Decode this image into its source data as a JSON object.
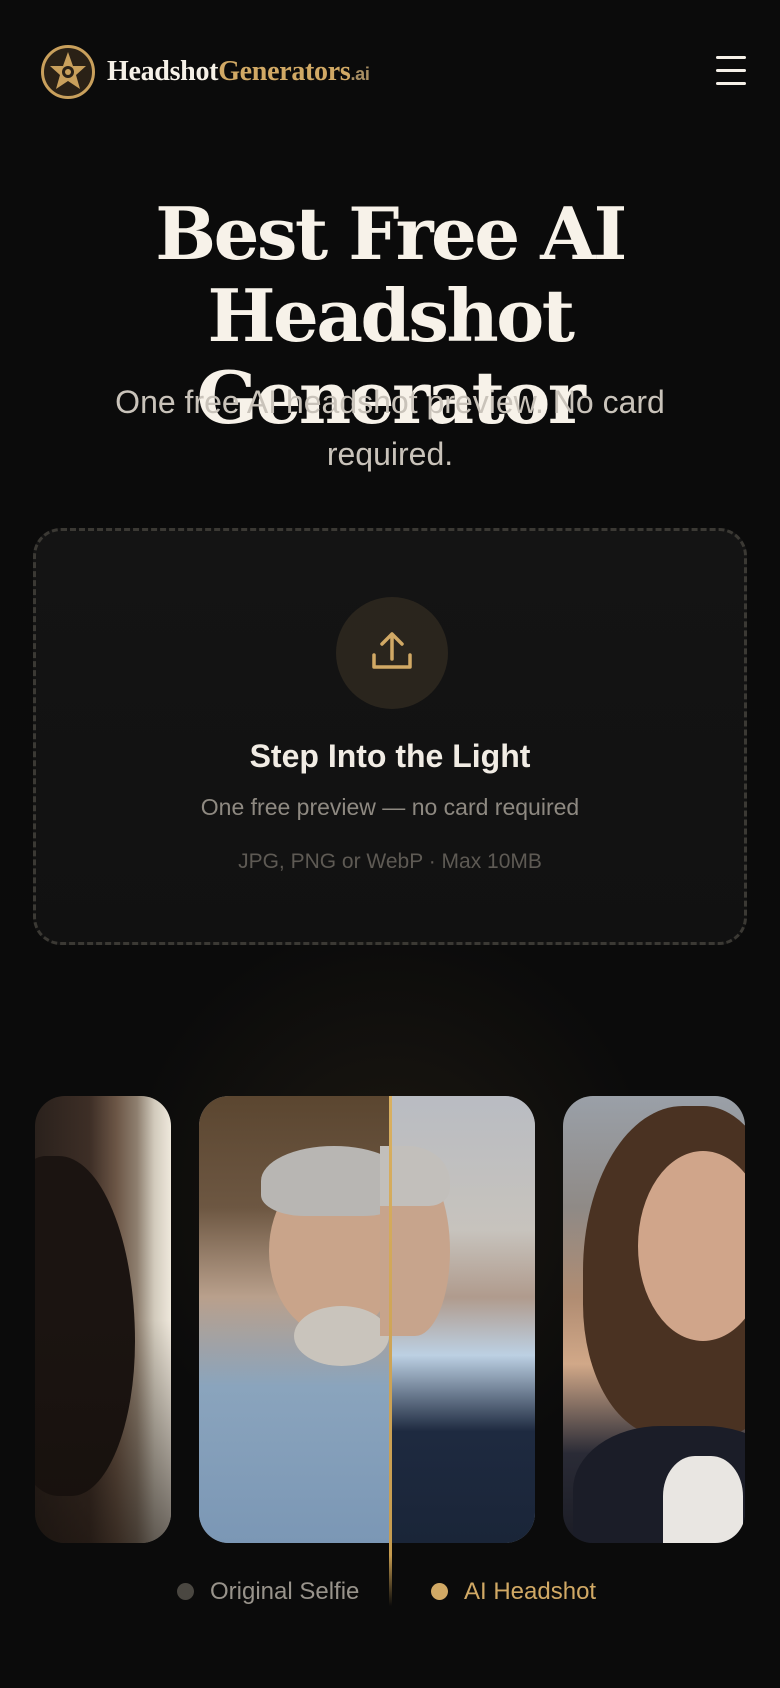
{
  "header": {
    "brand_part1": "Headshot",
    "brand_part2": "Generators",
    "brand_part3": ".ai",
    "logo_icon": "star-badge-icon",
    "menu_icon": "hamburger-menu-icon"
  },
  "hero": {
    "title_line1": "Best Free AI Headshot",
    "title_line2": "Generator",
    "subtitle": "One free AI headshot preview. No card required."
  },
  "upload": {
    "icon": "upload-icon",
    "title": "Step Into the Light",
    "subtitle": "One free preview — no card required",
    "formats": "JPG, PNG or WebP · Max 10MB"
  },
  "comparison": {
    "legend_original": "Original Selfie",
    "legend_ai": "AI Headshot"
  },
  "colors": {
    "background": "#0b0b0b",
    "accent_gold": "#d1a965",
    "text_primary": "#f6f1e8",
    "legend_original_dot": "#4a4741",
    "legend_ai_dot": "#d1a965"
  }
}
